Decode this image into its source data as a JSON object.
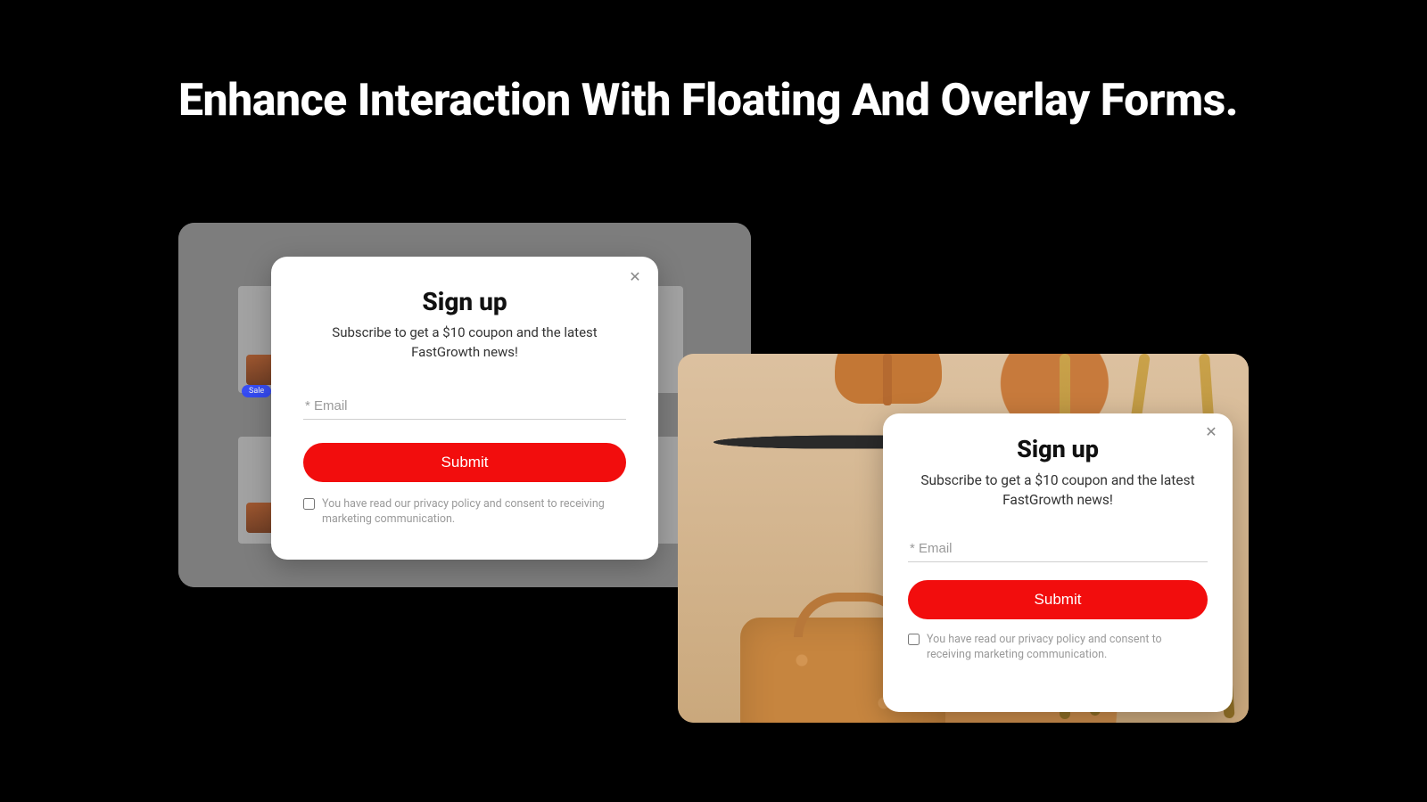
{
  "headline": "Enhance Interaction With Floating And Overlay Forms.",
  "modal1": {
    "title": "Sign up",
    "subtitle": "Subscribe to get a $10 coupon and the latest FastGrowth news!",
    "email_placeholder": "* Email",
    "submit_label": "Submit",
    "consent_text": "You have read our privacy policy and consent to receiving marketing communication.",
    "sale_badge": "Sale"
  },
  "modal2": {
    "title": "Sign up",
    "subtitle": "Subscribe to get a $10 coupon and the latest FastGrowth news!",
    "email_placeholder": "* Email",
    "submit_label": "Submit",
    "consent_text": "You have read our privacy policy and consent to receiving marketing communication."
  },
  "colors": {
    "accent": "#f20d0d",
    "sale_pill": "#2d46ff"
  }
}
